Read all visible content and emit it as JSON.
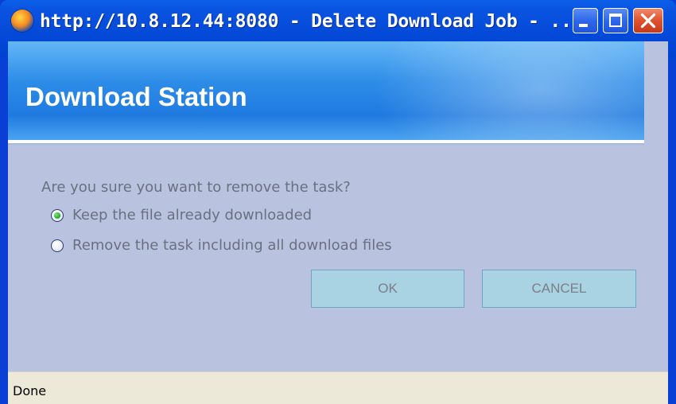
{
  "window": {
    "title": "http://10.8.12.44:8080 - Delete Download Job - ...",
    "icon": "firefox-icon",
    "controls": {
      "minimize": "minimize-icon",
      "maximize": "maximize-icon",
      "close": "close-icon"
    }
  },
  "banner": {
    "title": "Download Station"
  },
  "dialog": {
    "question": "Are you sure you want to remove the task?",
    "options": [
      {
        "label": "Keep the file already downloaded",
        "selected": true
      },
      {
        "label": "Remove the task including all download files",
        "selected": false
      }
    ],
    "ok_label": "OK",
    "cancel_label": "CANCEL"
  },
  "status_bar": {
    "text": "Done"
  },
  "colors": {
    "titlebar": "#0349d8",
    "banner": "#2e8de8",
    "client_bg": "#b9c3df",
    "button_bg": "#a9d2e2",
    "status_bg": "#ece9d8"
  }
}
